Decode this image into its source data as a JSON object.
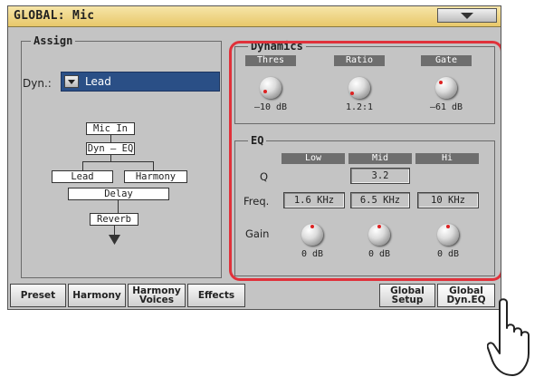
{
  "window": {
    "title": "GLOBAL: Mic"
  },
  "assign": {
    "legend": "Assign",
    "dyn_label": "Dyn.:",
    "dyn_value": "Lead",
    "chain": {
      "mic_in": "Mic In",
      "dyn_eq": "Dyn – EQ",
      "lead": "Lead",
      "harmony": "Harmony",
      "delay": "Delay",
      "reverb": "Reverb"
    }
  },
  "dynamics": {
    "legend": "Dynamics",
    "knobs": [
      {
        "label": "Thres",
        "value": "–10 dB"
      },
      {
        "label": "Ratio",
        "value": "1.2:1"
      },
      {
        "label": "Gate",
        "value": "–61 dB"
      }
    ]
  },
  "eq": {
    "legend": "EQ",
    "bands": [
      "Low",
      "Mid",
      "Hi"
    ],
    "q_label": "Q",
    "q_mid": "3.2",
    "freq_label": "Freq.",
    "freq": [
      "1.6 KHz",
      "6.5 KHz",
      "10 KHz"
    ],
    "gain_label": "Gain",
    "gain": [
      "0 dB",
      "0 dB",
      "0 dB"
    ]
  },
  "tabs": [
    {
      "label": "Preset"
    },
    {
      "label": "Harmony"
    },
    {
      "label": "Harmony\nVoices"
    },
    {
      "label": "Effects"
    },
    {
      "label": "Global\nSetup"
    },
    {
      "label": "Global\nDyn.EQ"
    }
  ]
}
